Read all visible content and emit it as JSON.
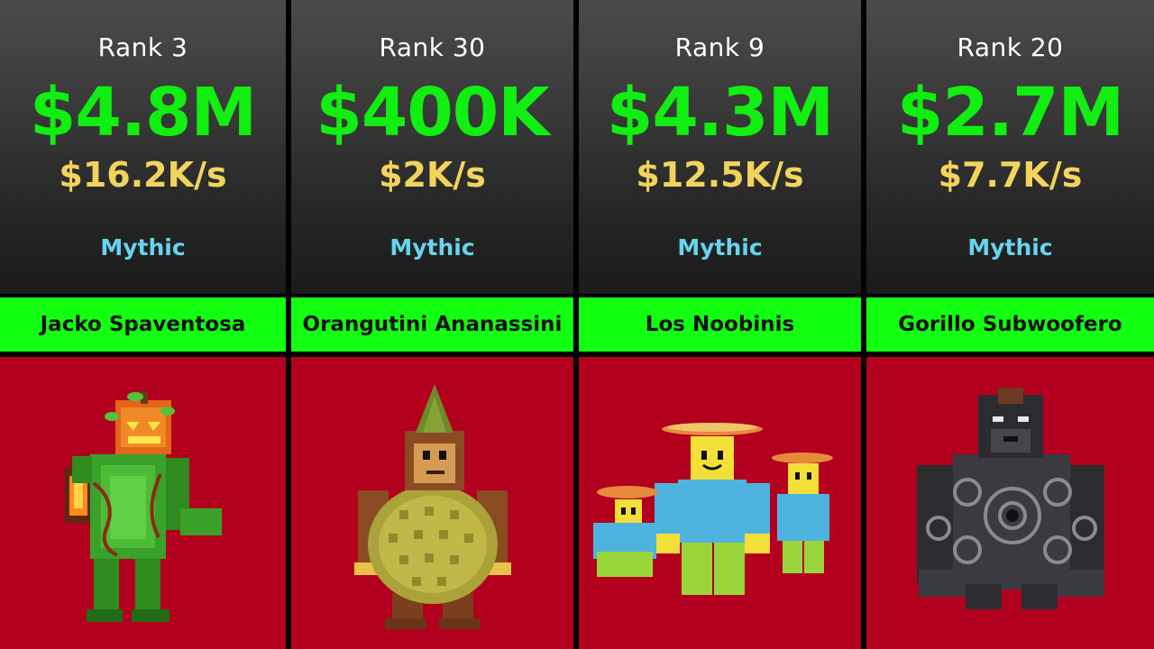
{
  "cards": [
    {
      "rank": "Rank 3",
      "price": "$4.8M",
      "rate": "$16.2K/s",
      "rarity": "Mythic",
      "name": "Jacko Spaventosa"
    },
    {
      "rank": "Rank 30",
      "price": "$400K",
      "rate": "$2K/s",
      "rarity": "Mythic",
      "name": "Orangutini Ananassini"
    },
    {
      "rank": "Rank 9",
      "price": "$4.3M",
      "rate": "$12.5K/s",
      "rarity": "Mythic",
      "name": "Los Noobinis"
    },
    {
      "rank": "Rank 20",
      "price": "$2.7M",
      "rate": "$7.7K/s",
      "rarity": "Mythic",
      "name": "Gorillo Subwoofero"
    }
  ],
  "colors": {
    "price": "#11ee11",
    "rate": "#f2d45c",
    "rarity": "#66d4ee",
    "name_bar": "#12ff12",
    "picture_bg": "#b2001e"
  }
}
